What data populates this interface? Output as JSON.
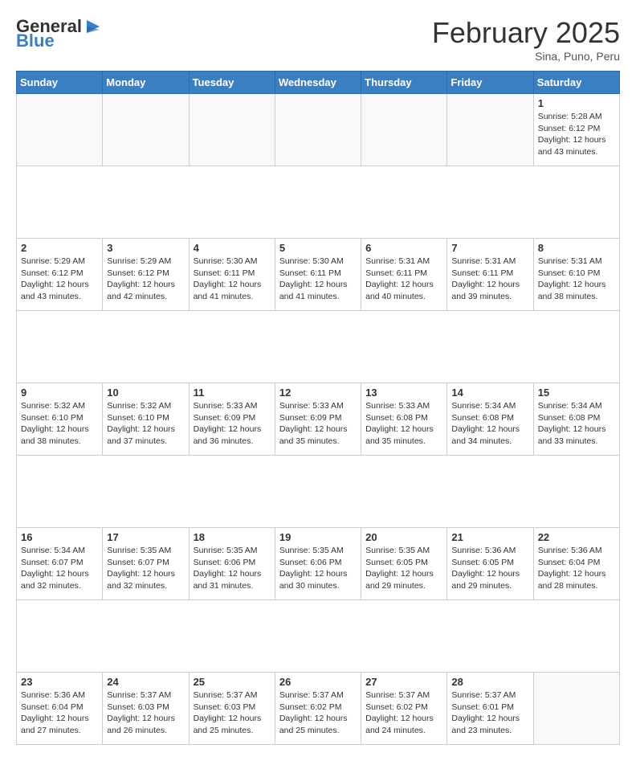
{
  "header": {
    "logo_general": "General",
    "logo_blue": "Blue",
    "month": "February 2025",
    "location": "Sina, Puno, Peru"
  },
  "weekdays": [
    "Sunday",
    "Monday",
    "Tuesday",
    "Wednesday",
    "Thursday",
    "Friday",
    "Saturday"
  ],
  "weeks": [
    [
      {
        "day": "",
        "info": ""
      },
      {
        "day": "",
        "info": ""
      },
      {
        "day": "",
        "info": ""
      },
      {
        "day": "",
        "info": ""
      },
      {
        "day": "",
        "info": ""
      },
      {
        "day": "",
        "info": ""
      },
      {
        "day": "1",
        "info": "Sunrise: 5:28 AM\nSunset: 6:12 PM\nDaylight: 12 hours\nand 43 minutes."
      }
    ],
    [
      {
        "day": "2",
        "info": "Sunrise: 5:29 AM\nSunset: 6:12 PM\nDaylight: 12 hours\nand 43 minutes."
      },
      {
        "day": "3",
        "info": "Sunrise: 5:29 AM\nSunset: 6:12 PM\nDaylight: 12 hours\nand 42 minutes."
      },
      {
        "day": "4",
        "info": "Sunrise: 5:30 AM\nSunset: 6:11 PM\nDaylight: 12 hours\nand 41 minutes."
      },
      {
        "day": "5",
        "info": "Sunrise: 5:30 AM\nSunset: 6:11 PM\nDaylight: 12 hours\nand 41 minutes."
      },
      {
        "day": "6",
        "info": "Sunrise: 5:31 AM\nSunset: 6:11 PM\nDaylight: 12 hours\nand 40 minutes."
      },
      {
        "day": "7",
        "info": "Sunrise: 5:31 AM\nSunset: 6:11 PM\nDaylight: 12 hours\nand 39 minutes."
      },
      {
        "day": "8",
        "info": "Sunrise: 5:31 AM\nSunset: 6:10 PM\nDaylight: 12 hours\nand 38 minutes."
      }
    ],
    [
      {
        "day": "9",
        "info": "Sunrise: 5:32 AM\nSunset: 6:10 PM\nDaylight: 12 hours\nand 38 minutes."
      },
      {
        "day": "10",
        "info": "Sunrise: 5:32 AM\nSunset: 6:10 PM\nDaylight: 12 hours\nand 37 minutes."
      },
      {
        "day": "11",
        "info": "Sunrise: 5:33 AM\nSunset: 6:09 PM\nDaylight: 12 hours\nand 36 minutes."
      },
      {
        "day": "12",
        "info": "Sunrise: 5:33 AM\nSunset: 6:09 PM\nDaylight: 12 hours\nand 35 minutes."
      },
      {
        "day": "13",
        "info": "Sunrise: 5:33 AM\nSunset: 6:08 PM\nDaylight: 12 hours\nand 35 minutes."
      },
      {
        "day": "14",
        "info": "Sunrise: 5:34 AM\nSunset: 6:08 PM\nDaylight: 12 hours\nand 34 minutes."
      },
      {
        "day": "15",
        "info": "Sunrise: 5:34 AM\nSunset: 6:08 PM\nDaylight: 12 hours\nand 33 minutes."
      }
    ],
    [
      {
        "day": "16",
        "info": "Sunrise: 5:34 AM\nSunset: 6:07 PM\nDaylight: 12 hours\nand 32 minutes."
      },
      {
        "day": "17",
        "info": "Sunrise: 5:35 AM\nSunset: 6:07 PM\nDaylight: 12 hours\nand 32 minutes."
      },
      {
        "day": "18",
        "info": "Sunrise: 5:35 AM\nSunset: 6:06 PM\nDaylight: 12 hours\nand 31 minutes."
      },
      {
        "day": "19",
        "info": "Sunrise: 5:35 AM\nSunset: 6:06 PM\nDaylight: 12 hours\nand 30 minutes."
      },
      {
        "day": "20",
        "info": "Sunrise: 5:35 AM\nSunset: 6:05 PM\nDaylight: 12 hours\nand 29 minutes."
      },
      {
        "day": "21",
        "info": "Sunrise: 5:36 AM\nSunset: 6:05 PM\nDaylight: 12 hours\nand 29 minutes."
      },
      {
        "day": "22",
        "info": "Sunrise: 5:36 AM\nSunset: 6:04 PM\nDaylight: 12 hours\nand 28 minutes."
      }
    ],
    [
      {
        "day": "23",
        "info": "Sunrise: 5:36 AM\nSunset: 6:04 PM\nDaylight: 12 hours\nand 27 minutes."
      },
      {
        "day": "24",
        "info": "Sunrise: 5:37 AM\nSunset: 6:03 PM\nDaylight: 12 hours\nand 26 minutes."
      },
      {
        "day": "25",
        "info": "Sunrise: 5:37 AM\nSunset: 6:03 PM\nDaylight: 12 hours\nand 25 minutes."
      },
      {
        "day": "26",
        "info": "Sunrise: 5:37 AM\nSunset: 6:02 PM\nDaylight: 12 hours\nand 25 minutes."
      },
      {
        "day": "27",
        "info": "Sunrise: 5:37 AM\nSunset: 6:02 PM\nDaylight: 12 hours\nand 24 minutes."
      },
      {
        "day": "28",
        "info": "Sunrise: 5:37 AM\nSunset: 6:01 PM\nDaylight: 12 hours\nand 23 minutes."
      },
      {
        "day": "",
        "info": ""
      }
    ]
  ]
}
